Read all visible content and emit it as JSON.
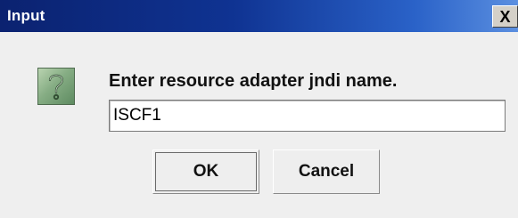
{
  "window": {
    "title": "Input",
    "close_glyph": "X"
  },
  "dialog": {
    "icon": "question-icon",
    "prompt": "Enter resource adapter jndi name.",
    "input_value": "ISCF1",
    "ok_label": "OK",
    "cancel_label": "Cancel"
  },
  "colors": {
    "title_bar_start": "#0b2270",
    "title_bar_end": "#5b8fe0",
    "dialog_background": "#efefef",
    "icon_green": "#86ad84"
  }
}
